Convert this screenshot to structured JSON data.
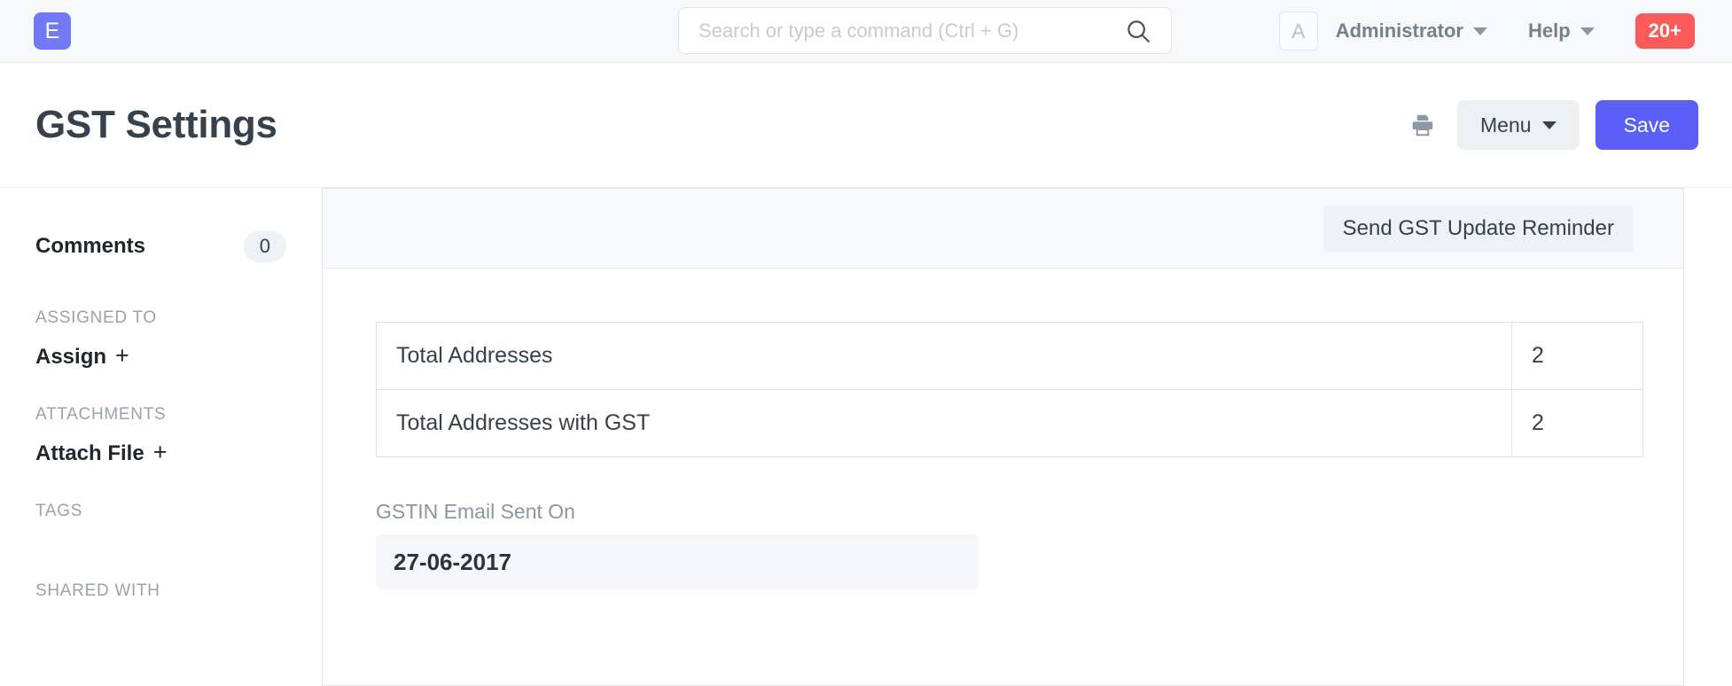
{
  "navbar": {
    "brand_letter": "E",
    "brand_color": "#7279f5",
    "search": {
      "placeholder": "Search or type a command (Ctrl + G)",
      "value": "",
      "icon": "search-icon"
    },
    "avatar_letter": "A",
    "user_label": "Administrator",
    "help_label": "Help",
    "notification_badge": "20+",
    "notification_color": "#fb5a5a"
  },
  "page_head": {
    "title": "GST Settings",
    "print_icon": "printer-icon",
    "menu_label": "Menu",
    "save_label": "Save",
    "save_color": "#5b5ef7"
  },
  "sidebar": {
    "comments_label": "Comments",
    "comments_count": "0",
    "sections": [
      {
        "label": "ASSIGNED TO",
        "action": "Assign",
        "plus": "+"
      },
      {
        "label": "ATTACHMENTS",
        "action": "Attach File",
        "plus": "+"
      },
      {
        "label": "TAGS",
        "action": "",
        "plus": ""
      },
      {
        "label": "SHARED WITH",
        "action": "",
        "plus": ""
      }
    ]
  },
  "main": {
    "toolbar": {
      "reminder_label": "Send GST Update Reminder"
    },
    "stats": [
      {
        "label": "Total Addresses",
        "value": "2"
      },
      {
        "label": "Total Addresses with GST",
        "value": "2"
      }
    ],
    "gstin_field": {
      "label": "GSTIN Email Sent On",
      "value": "27-06-2017"
    }
  }
}
